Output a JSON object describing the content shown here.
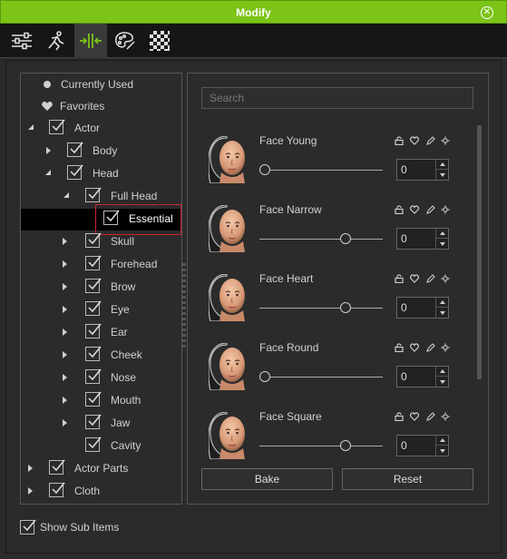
{
  "window": {
    "title": "Modify"
  },
  "toolbar": {
    "tabs": [
      {
        "icon": "sliders-icon",
        "active": false
      },
      {
        "icon": "figure-pose-icon",
        "active": false
      },
      {
        "icon": "morph-icon",
        "active": true
      },
      {
        "icon": "palette-icon",
        "active": false
      },
      {
        "icon": "checker-icon",
        "active": false
      }
    ]
  },
  "tree": {
    "items": [
      {
        "label": "Currently Used",
        "icon": "dot-icon"
      },
      {
        "label": "Favorites",
        "icon": "heart-icon"
      },
      {
        "label": "Actor",
        "expanded": true
      },
      {
        "label": "Body",
        "expanded": false
      },
      {
        "label": "Head",
        "expanded": true
      },
      {
        "label": "Full Head",
        "expanded": true
      },
      {
        "label": "Essential",
        "selected": true
      },
      {
        "label": "Skull"
      },
      {
        "label": "Forehead"
      },
      {
        "label": "Brow"
      },
      {
        "label": "Eye"
      },
      {
        "label": "Ear"
      },
      {
        "label": "Cheek"
      },
      {
        "label": "Nose"
      },
      {
        "label": "Mouth"
      },
      {
        "label": "Jaw"
      },
      {
        "label": "Cavity"
      },
      {
        "label": "Actor Parts"
      },
      {
        "label": "Cloth"
      }
    ]
  },
  "search": {
    "placeholder": "Search"
  },
  "morphs": [
    {
      "name": "Face Young",
      "value": "0",
      "slider": 0.0
    },
    {
      "name": "Face Narrow",
      "value": "0",
      "slider": 0.5
    },
    {
      "name": "Face Heart",
      "value": "0",
      "slider": 0.5
    },
    {
      "name": "Face Round",
      "value": "0",
      "slider": 0.0
    },
    {
      "name": "Face Square",
      "value": "0",
      "slider": 0.5
    }
  ],
  "buttons": {
    "bake": "Bake",
    "reset": "Reset"
  },
  "footer": {
    "show_sub_items": "Show Sub Items"
  },
  "colors": {
    "accent": "#7cc417",
    "selection_border": "#c7262c"
  }
}
